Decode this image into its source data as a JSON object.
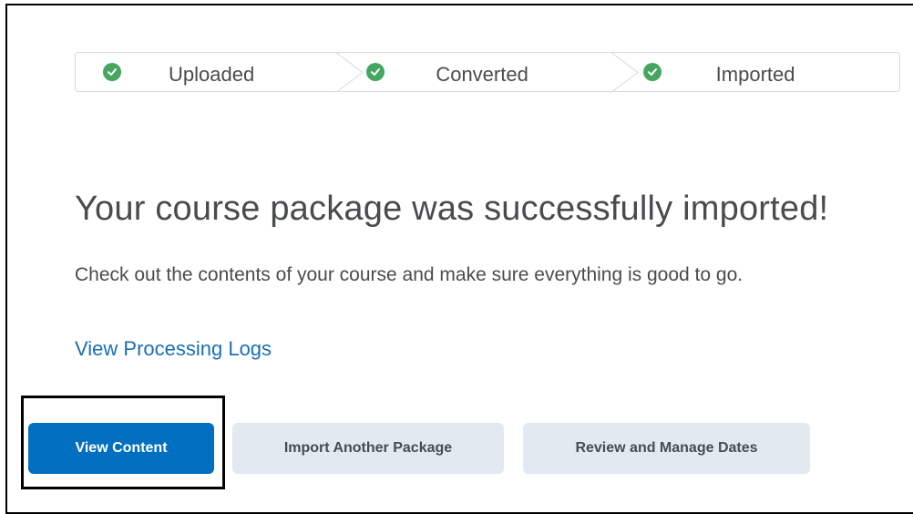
{
  "steps": [
    {
      "label": "Uploaded",
      "icon": "check-circle-icon"
    },
    {
      "label": "Converted",
      "icon": "check-circle-icon"
    },
    {
      "label": "Imported",
      "icon": "check-circle-icon"
    }
  ],
  "main": {
    "title": "Your course package was successfully imported!",
    "description": "Check out the contents of your course and make sure everything is good to go.",
    "logs_link": "View Processing Logs"
  },
  "buttons": {
    "view_content": "View Content",
    "import_another": "Import Another Package",
    "review_dates": "Review and Manage Dates"
  },
  "colors": {
    "success": "#46a661",
    "primary": "#006fbf",
    "link": "#1a6fb5",
    "secondary_bg": "#e3e9f1"
  }
}
